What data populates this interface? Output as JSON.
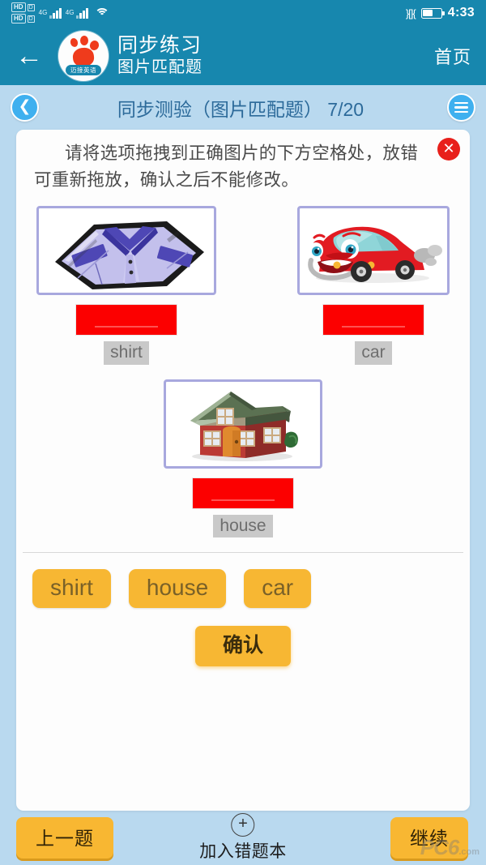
{
  "statusbar": {
    "hd_label": "HD",
    "hd_sub": "D",
    "network_a": "4G",
    "network_b": "4G",
    "wifi_icon": "wifi-icon",
    "vibrate_icon": "vibrate-icon",
    "battery_icon": "battery-icon",
    "time": "4:33"
  },
  "appbar": {
    "back_icon": "back-arrow-icon",
    "logo_icon": "paw-logo-icon",
    "logo_banner": "迈接英语",
    "title": "同步练习",
    "subtitle": "图片匹配题",
    "home_label": "首页"
  },
  "subbar": {
    "back_circle_icon": "circle-back-icon",
    "title": "同步测验（图片匹配题） 7/20",
    "menu_icon": "hamburger-menu-icon"
  },
  "card": {
    "close_icon": "close-x-icon",
    "instructions": "请将选项拖拽到正确图片的下方空格处，放错可重新拖放，确认之后不能修改。",
    "items": [
      {
        "image_icon": "shirt-image",
        "answer": "shirt",
        "slot_state": "empty-red"
      },
      {
        "image_icon": "car-image",
        "answer": "car",
        "slot_state": "empty-red"
      },
      {
        "image_icon": "house-image",
        "answer": "house",
        "slot_state": "empty-red"
      }
    ],
    "word_bank": [
      "shirt",
      "house",
      "car"
    ],
    "confirm_label": "确认"
  },
  "bottombar": {
    "prev_label": "上一题",
    "add_icon": "plus-circle-icon",
    "add_label": "加入错题本",
    "next_label": "继续"
  },
  "watermark": {
    "text": "PC6",
    "suffix": ".com"
  },
  "colors": {
    "header_blue": "#1787ae",
    "page_blue": "#b9d9ef",
    "accent_orange": "#f7b733",
    "slot_red": "#fc0000",
    "close_red": "#e8201b",
    "frame_purple": "#a8a8de",
    "tag_gray": "#c9c9c9"
  }
}
